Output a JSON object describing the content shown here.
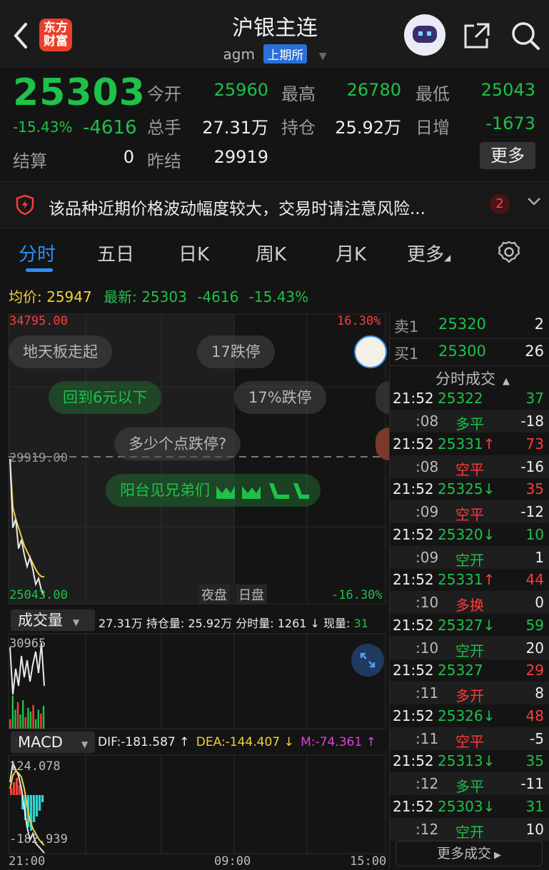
{
  "header": {
    "back_icon": "chevron-left-icon",
    "logo_text_1": "东方",
    "logo_text_2": "财富",
    "title": "沪银主连",
    "symbol": "agm",
    "exchange": "上期所"
  },
  "quote": {
    "price": "25303",
    "pct": "-15.43%",
    "change": "-4616",
    "open_label": "今开",
    "open": "25960",
    "high_label": "最高",
    "high": "26780",
    "low_label": "最低",
    "low": "25043",
    "volume_label": "总手",
    "volume": "27.31万",
    "oi_label": "持仓",
    "oi": "25.92万",
    "daily_label": "日增",
    "daily": "-1673",
    "settle_label": "结算",
    "settle": "0",
    "prev_label": "昨结",
    "prev": "29919",
    "more_label": "更多"
  },
  "notice": {
    "text": "该品种近期价格波动幅度较大，交易时请注意风险...",
    "count": "2"
  },
  "tabs": [
    "分时",
    "五日",
    "日K",
    "周K",
    "月K",
    "更多"
  ],
  "info": {
    "avg_label": "均价:",
    "avg": "25947",
    "latest_label": "最新:",
    "latest": "25303",
    "change": "-4616",
    "pct": "-15.43%"
  },
  "chart": {
    "top_price": "34795.00",
    "top_pct": "16.30%",
    "prev_line": "29919.00",
    "bottom_price": "25043.00",
    "bottom_pct": "-16.30%",
    "session_night": "夜盘",
    "session_day": "日盘",
    "chips": [
      "地天板走起",
      "17跌停",
      "回到6元以下",
      "17%跌停",
      "多少个点跌停?",
      "阳台见兄弟们"
    ],
    "vol_label": "成交量",
    "vol_info": "27.31万 持仓量: 25.92万 分时量: 1261 ↓ 现量: ",
    "vol_now": "31",
    "vol_max": "30965",
    "macd_label": "MACD",
    "dif": "DIF:-181.587 ↑",
    "dea": "DEA:-144.407 ↓",
    "m": "M:-74.361 ↑",
    "macd_top": "124.078",
    "macd_bottom": "-182.939",
    "time_start": "21:00",
    "time_mid": "09:00",
    "time_end": "15:00",
    "price_line": [
      29919,
      27600,
      27900,
      26900,
      27200,
      26700,
      26300,
      26600,
      26200,
      25700,
      25900,
      25500,
      25303
    ],
    "avg_line": [
      29919,
      28300,
      27900,
      27600,
      27300,
      27000,
      26800,
      26600,
      26400,
      26200,
      26050,
      25960,
      25947
    ],
    "ylim": [
      25043,
      34795
    ]
  },
  "book": {
    "sell_label": "卖1",
    "sell_price": "25320",
    "sell_qty": "2",
    "buy_label": "买1",
    "buy_price": "25300",
    "buy_qty": "26",
    "trades_title": "分时成交",
    "more_trades": "更多成交",
    "trades": [
      {
        "t": "21:52",
        "p": "25322",
        "arrow": "",
        "pc": "green",
        "q": "37",
        "qc": "green",
        "sub": ":08",
        "type": "多平",
        "tc": "green",
        "n": "-18"
      },
      {
        "t": "21:52",
        "p": "25331",
        "arrow": "↑",
        "pc": "green",
        "q": "73",
        "qc": "red",
        "sub": ":08",
        "type": "空平",
        "tc": "red",
        "n": "-16"
      },
      {
        "t": "21:52",
        "p": "25325",
        "arrow": "↓",
        "pc": "green",
        "q": "35",
        "qc": "red",
        "sub": ":09",
        "type": "空平",
        "tc": "red",
        "n": "-12"
      },
      {
        "t": "21:52",
        "p": "25320",
        "arrow": "↓",
        "pc": "green",
        "q": "10",
        "qc": "green",
        "sub": ":09",
        "type": "空开",
        "tc": "green",
        "n": "1"
      },
      {
        "t": "21:52",
        "p": "25331",
        "arrow": "↑",
        "pc": "green",
        "q": "44",
        "qc": "red",
        "sub": ":10",
        "type": "多换",
        "tc": "red",
        "n": "0"
      },
      {
        "t": "21:52",
        "p": "25327",
        "arrow": "↓",
        "pc": "green",
        "q": "59",
        "qc": "green",
        "sub": ":10",
        "type": "空开",
        "tc": "green",
        "n": "20"
      },
      {
        "t": "21:52",
        "p": "25327",
        "arrow": "",
        "pc": "green",
        "q": "29",
        "qc": "red",
        "sub": ":11",
        "type": "多开",
        "tc": "red",
        "n": "8"
      },
      {
        "t": "21:52",
        "p": "25326",
        "arrow": "↓",
        "pc": "green",
        "q": "48",
        "qc": "red",
        "sub": ":11",
        "type": "空平",
        "tc": "red",
        "n": "-5"
      },
      {
        "t": "21:52",
        "p": "25313",
        "arrow": "↓",
        "pc": "green",
        "q": "35",
        "qc": "green",
        "sub": ":12",
        "type": "多平",
        "tc": "green",
        "n": "-11"
      },
      {
        "t": "21:52",
        "p": "25303",
        "arrow": "↓",
        "pc": "green",
        "q": "31",
        "qc": "green",
        "sub": ":12",
        "type": "空开",
        "tc": "green",
        "n": "10"
      }
    ]
  },
  "colors": {
    "up": "#ff3b3b",
    "down": "#1ec14a",
    "avg": "#f2d13b",
    "accent": "#2f8ff5"
  }
}
